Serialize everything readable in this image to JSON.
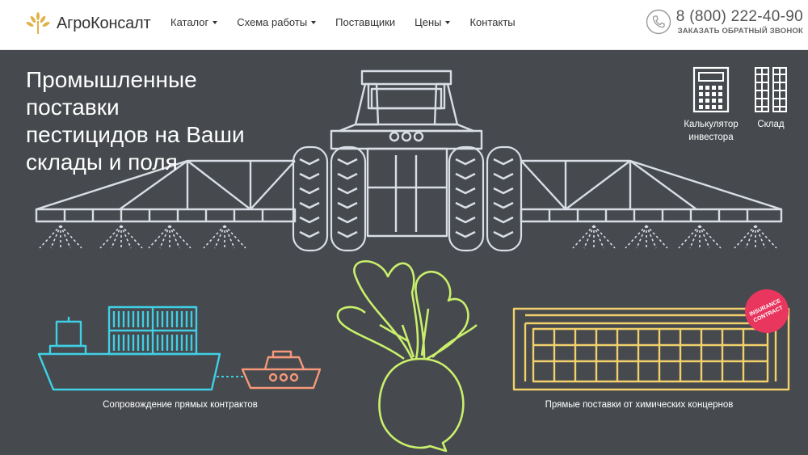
{
  "header": {
    "logo_text": "АгроКонсалт",
    "nav": [
      {
        "label": "Каталог",
        "has_dropdown": true
      },
      {
        "label": "Схема работы",
        "has_dropdown": true
      },
      {
        "label": "Поставщики",
        "has_dropdown": false
      },
      {
        "label": "Цены",
        "has_dropdown": true
      },
      {
        "label": "Контакты",
        "has_dropdown": false
      }
    ],
    "phone": "8 (800) 222-40-90",
    "callback": "ЗАКАЗАТЬ ОБРАТНЫЙ ЗВОНОК"
  },
  "hero": {
    "title_lines": [
      "Промышленные поставки",
      "пестицидов на Ваши",
      "склады и поля"
    ],
    "tools": {
      "calculator": {
        "line1": "Калькулятор",
        "line2": "инвестора",
        "icon": "calculator-icon"
      },
      "warehouse": {
        "label": "Склад",
        "icon": "warehouse-icon"
      }
    },
    "caption_left": "Сопровождение прямых контрактов",
    "caption_right": "Прямые поставки от химических концернов",
    "badge_line1": "INSURANCE",
    "badge_line2": "CONTRACT"
  },
  "colors": {
    "background": "#46494d",
    "tractor": "#d9dee6",
    "ship": "#3fd0e6",
    "boat": "#f5997a",
    "beet": "#c9ef6b",
    "warehouse": "#f2d06b",
    "badge": "#e8365f"
  }
}
